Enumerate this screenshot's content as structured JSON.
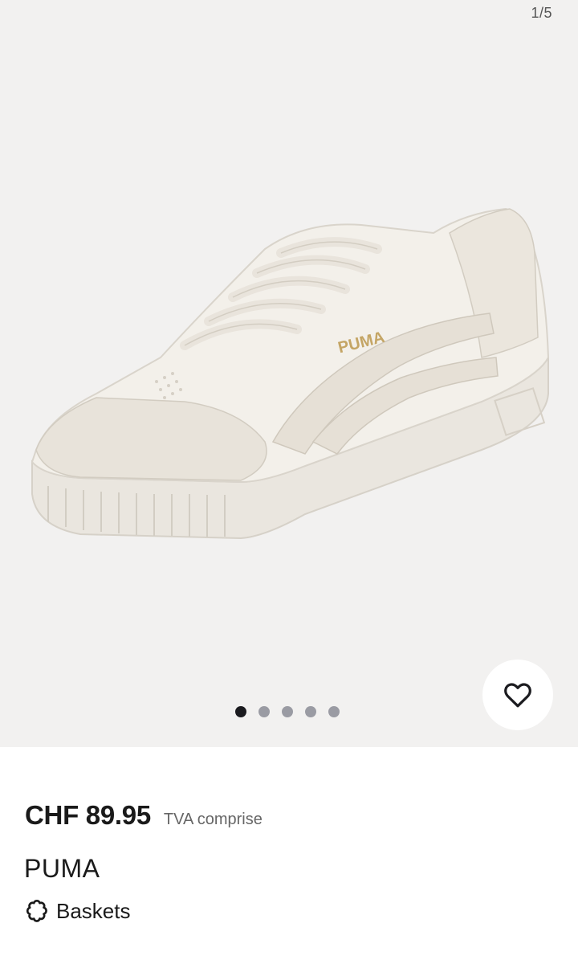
{
  "gallery": {
    "counter": "1/5",
    "image_alt_name": "sneaker-image",
    "dots_total": 5,
    "dots_active_index": 0,
    "favorite_icon": "heart-outline-icon",
    "logo_text": "PUMA"
  },
  "product": {
    "price": "CHF 89.95",
    "vat_note": "TVA comprise",
    "brand": "PUMA",
    "category_icon": "flower-badge-icon",
    "category": "Baskets"
  },
  "colors": {
    "gallery_bg": "#f2f1f0",
    "dot_active": "#1b1b1f",
    "dot_inactive": "#9a9ba3",
    "text_primary": "#1a1a1a",
    "text_secondary": "#666666"
  }
}
